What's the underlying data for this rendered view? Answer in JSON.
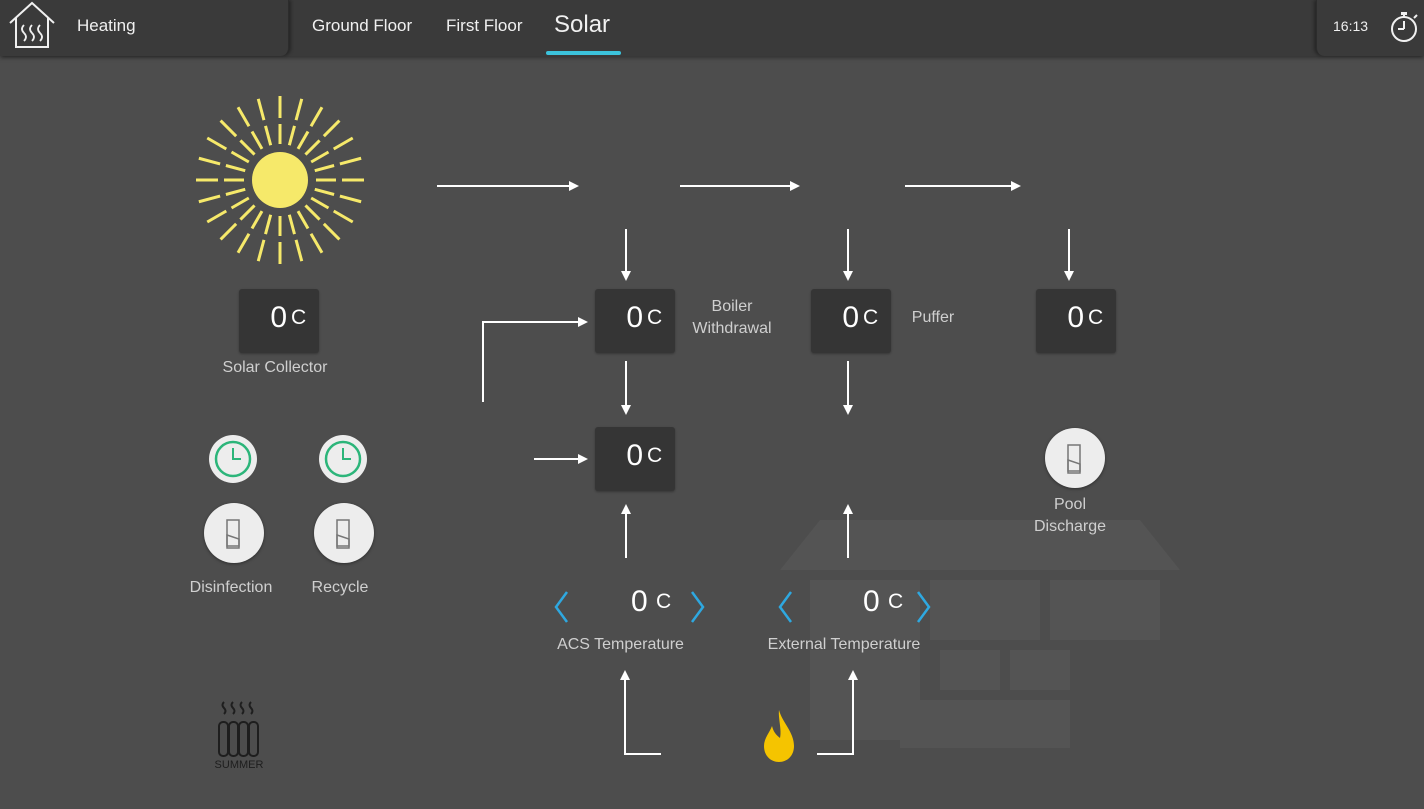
{
  "header": {
    "app_title": "Heating",
    "app_icon": "heating-house-icon",
    "tabs": [
      {
        "label": "Ground Floor",
        "active": false
      },
      {
        "label": "First Floor",
        "active": false
      },
      {
        "label": "Solar",
        "active": true
      }
    ],
    "time": "16:13",
    "timer_icon": "stopwatch-icon",
    "accent_color": "#3cc3dc"
  },
  "solar_collector": {
    "value": "0",
    "unit": "C",
    "label": "Solar Collector",
    "icon": "sun-icon",
    "sun_color": "#f6e96a"
  },
  "boiler_withdrawal": {
    "value": "0",
    "unit": "C",
    "label_line1": "Boiler",
    "label_line2": "Withdrawal"
  },
  "puffer": {
    "value": "0",
    "unit": "C",
    "label": "Puffer"
  },
  "pool": {
    "value": "0",
    "unit": "C"
  },
  "boiler_lower": {
    "value": "0",
    "unit": "C"
  },
  "acs": {
    "value": "0",
    "unit": "C",
    "label": "ACS Temperature"
  },
  "external": {
    "value": "0",
    "unit": "C",
    "label": "External Temperature"
  },
  "switches": {
    "disinfection": {
      "label": "Disinfection",
      "icon": "switch-icon",
      "schedule_icon": "clock-icon"
    },
    "recycle": {
      "label": "Recycle",
      "icon": "switch-icon",
      "schedule_icon": "clock-icon"
    },
    "pool_discharge": {
      "label_line1": "Pool",
      "label_line2": "Discharge",
      "icon": "switch-icon"
    }
  },
  "mode": {
    "label": "SUMMER",
    "icon": "radiator-icon"
  },
  "flame_icon": "flame-icon",
  "flame_color": "#f5c400",
  "schedule_color": "#2cb57a"
}
